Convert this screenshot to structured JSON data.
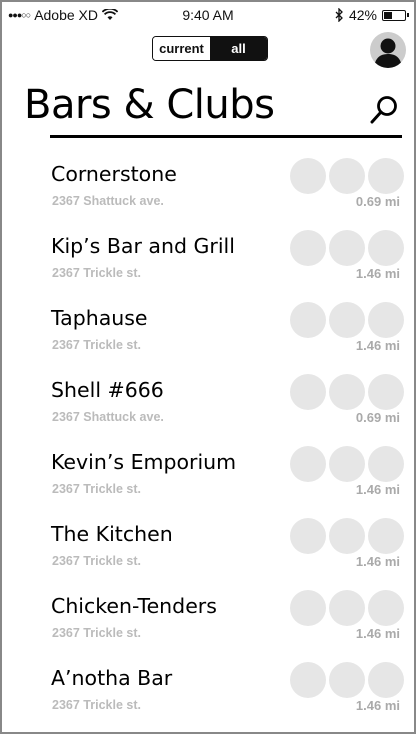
{
  "status_bar": {
    "carrier": "Adobe XD",
    "time": "9:40 AM",
    "battery": "42%",
    "battery_level": 0.42
  },
  "toggle": {
    "current_label": "current",
    "all_label": "all",
    "selected": "all"
  },
  "header": {
    "title": "Bars & Clubs"
  },
  "venues": [
    {
      "name": "Cornerstone",
      "address": "2367 Shattuck ave.",
      "distance": "0.69 mi"
    },
    {
      "name": "Kip’s Bar and Grill",
      "address": "2367 Trickle st.",
      "distance": "1.46 mi"
    },
    {
      "name": "Taphause",
      "address": "2367 Trickle st.",
      "distance": "1.46 mi"
    },
    {
      "name": "Shell #666",
      "address": "2367 Shattuck ave.",
      "distance": "0.69 mi"
    },
    {
      "name": "Kevin’s Emporium",
      "address": "2367 Trickle st.",
      "distance": "1.46 mi"
    },
    {
      "name": "The Kitchen",
      "address": "2367 Trickle st.",
      "distance": "1.46 mi"
    },
    {
      "name": "Chicken-Tenders",
      "address": "2367 Trickle st.",
      "distance": "1.46 mi"
    },
    {
      "name": "A’notha Bar",
      "address": "2367 Trickle st.",
      "distance": "1.46 mi"
    }
  ],
  "icons": {
    "profile": "user-avatar-icon",
    "search": "search-icon",
    "wifi": "wifi-icon",
    "bluetooth": "bluetooth-icon",
    "signal": "signal-icon",
    "battery": "battery-icon"
  }
}
